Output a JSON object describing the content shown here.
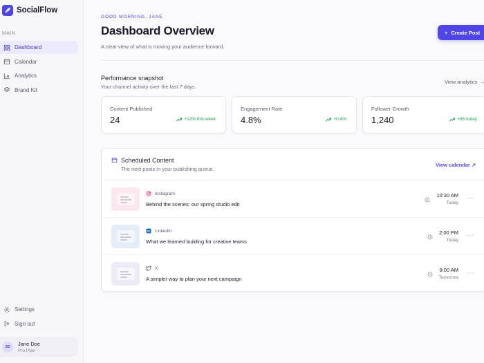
{
  "app": {
    "name": "SocialFlow"
  },
  "sidebar": {
    "section_label": "MAIN",
    "items": [
      {
        "label": "Dashboard",
        "icon": "grid-icon",
        "active": true
      },
      {
        "label": "Calendar",
        "icon": "calendar-icon",
        "active": false
      },
      {
        "label": "Analytics",
        "icon": "bar-chart-icon",
        "active": false
      },
      {
        "label": "Brand Kit",
        "icon": "layers-icon",
        "active": false
      }
    ],
    "bottom_items": [
      {
        "label": "Settings",
        "icon": "gear-icon"
      },
      {
        "label": "Sign out",
        "icon": "sign-out-icon"
      }
    ],
    "user": {
      "initials": "JD",
      "name": "Jane Doe",
      "plan": "Pro Plan"
    }
  },
  "header": {
    "greeting": "GOOD MORNING, JANE",
    "title": "Dashboard Overview",
    "subtitle": "A clear view of what is moving your audience forward.",
    "create_label": "Create Post"
  },
  "snapshot": {
    "title": "Performance snapshot",
    "subtitle": "Your channel activity over the last 7 days.",
    "view_label": "View analytics",
    "stats": [
      {
        "label": "Content Published",
        "value": "24",
        "delta": "+12% this week"
      },
      {
        "label": "Engagement Rate",
        "value": "4.8%",
        "delta": "+0.4%"
      },
      {
        "label": "Follower Growth",
        "value": "1,240",
        "delta": "+85 today"
      }
    ]
  },
  "scheduled": {
    "title": "Scheduled Content",
    "subtitle": "The next posts in your publishing queue.",
    "view_label": "View calendar",
    "posts": [
      {
        "platform": "Instagram",
        "title": "Behind the scenes: our spring studio edit",
        "time": "10:30 AM",
        "day": "Today"
      },
      {
        "platform": "LinkedIn",
        "title": "What we learned building for creative teams",
        "time": "2:00 PM",
        "day": "Today"
      },
      {
        "platform": "X",
        "title": "A simpler way to plan your next campaign",
        "time": "9:00 AM",
        "day": "Tomorrow"
      }
    ]
  },
  "colors": {
    "accent": "#4f46e5",
    "positive": "#16a34a",
    "instagram_thumb": "#fde7ef",
    "linkedin_thumb": "#e4ecf8",
    "x_thumb": "#ecebf6"
  }
}
